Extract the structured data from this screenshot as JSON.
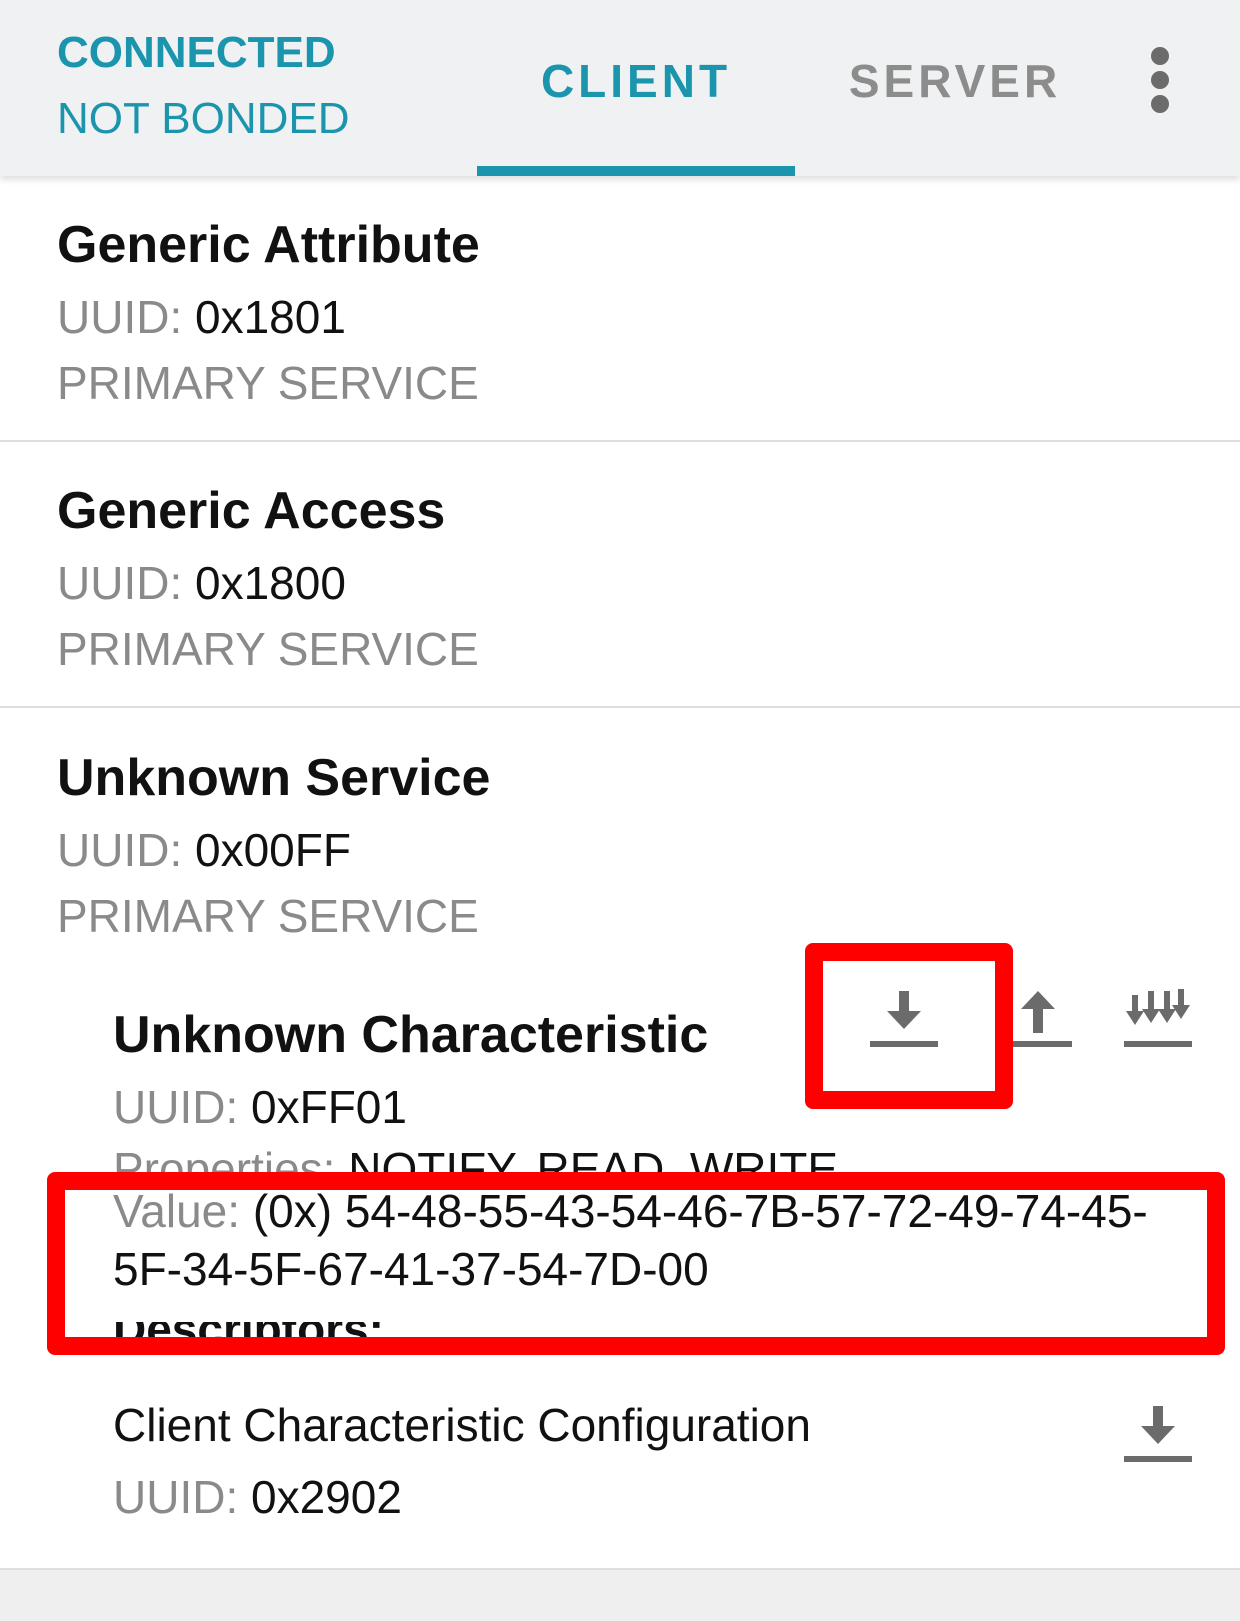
{
  "header": {
    "connection_status": "CONNECTED",
    "bond_status": "NOT BONDED",
    "tabs": [
      {
        "label": "CLIENT",
        "selected": true
      },
      {
        "label": "SERVER",
        "selected": false
      }
    ],
    "overflow_icon": "more-vert-icon",
    "accent_color": "#1b94ad"
  },
  "services": [
    {
      "name": "Generic Attribute",
      "uuid_label": "UUID:",
      "uuid": "0x1801",
      "type": "PRIMARY SERVICE"
    },
    {
      "name": "Generic Access",
      "uuid_label": "UUID:",
      "uuid": "0x1800",
      "type": "PRIMARY SERVICE"
    },
    {
      "name": "Unknown Service",
      "uuid_label": "UUID:",
      "uuid": "0x00FF",
      "type": "PRIMARY SERVICE",
      "characteristic": {
        "name": "Unknown Characteristic",
        "uuid_label": "UUID:",
        "uuid": "0xFF01",
        "properties_label": "Properties:",
        "properties": "NOTIFY, READ, WRITE",
        "value_label": "Value:",
        "value": "(0x) 54-48-55-43-54-46-7B-57-72-49-74-45-5F-34-5F-67-41-37-54-7D-00",
        "actions": [
          "read-icon",
          "write-icon",
          "notify-icon"
        ],
        "descriptors_label": "Descriptors:",
        "descriptor": {
          "name": "Client Characteristic Configuration",
          "uuid_label": "UUID:",
          "uuid": "0x2902",
          "action": "read-icon"
        }
      }
    }
  ],
  "highlight_color": "#ff0000"
}
